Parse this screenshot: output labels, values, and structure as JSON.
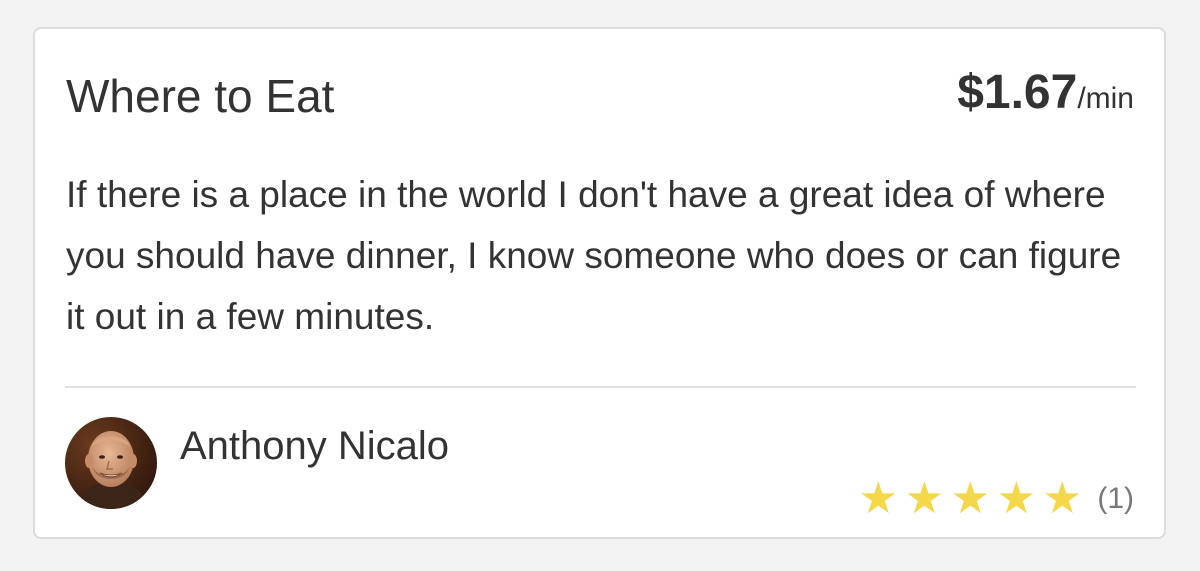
{
  "card": {
    "title": "Where to Eat",
    "price": {
      "amount": "$1.67",
      "unit": "/min"
    },
    "description": "If there is a place in the world I don't have a great idea of where you should have dinner, I know someone who does or can figure it out in a few minutes.",
    "author": {
      "name": "Anthony Nicalo",
      "avatar_icon": "person-avatar-photo"
    },
    "rating": {
      "stars": 5,
      "max_stars": 5,
      "count": "(1)",
      "star_color": "#f5d84a"
    }
  }
}
